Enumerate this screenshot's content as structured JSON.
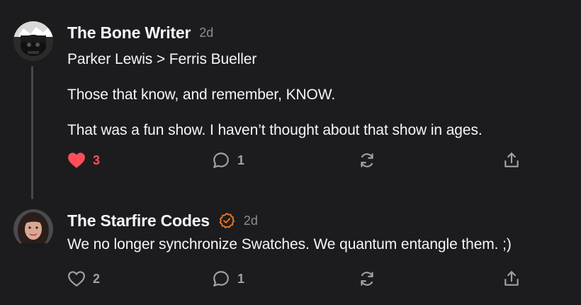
{
  "colors": {
    "background": "#1c1c1e",
    "text": "#f5f5f7",
    "muted": "#8e8e93",
    "liked": "#ff4d5a",
    "verified": "#e8731f"
  },
  "comments": [
    {
      "author": "The Bone Writer",
      "time": "2d",
      "verified": false,
      "paragraphs": [
        "Parker Lewis > Ferris Bueller",
        "Those that know, and remember, KNOW.",
        "That was a fun show. I haven’t thought about that show in ages."
      ],
      "likes": "3",
      "liked": true,
      "replies": "1",
      "icons": [
        "heart-filled-icon",
        "reply-bubble-icon",
        "restack-icon",
        "share-icon"
      ]
    },
    {
      "author": "The Starfire Codes",
      "time": "2d",
      "verified": true,
      "paragraphs": [
        "We no longer synchronize Swatches. We quantum entangle them. ;)"
      ],
      "likes": "2",
      "liked": false,
      "replies": "1",
      "icons": [
        "heart-outline-icon",
        "reply-bubble-icon",
        "restack-icon",
        "share-icon"
      ]
    }
  ]
}
